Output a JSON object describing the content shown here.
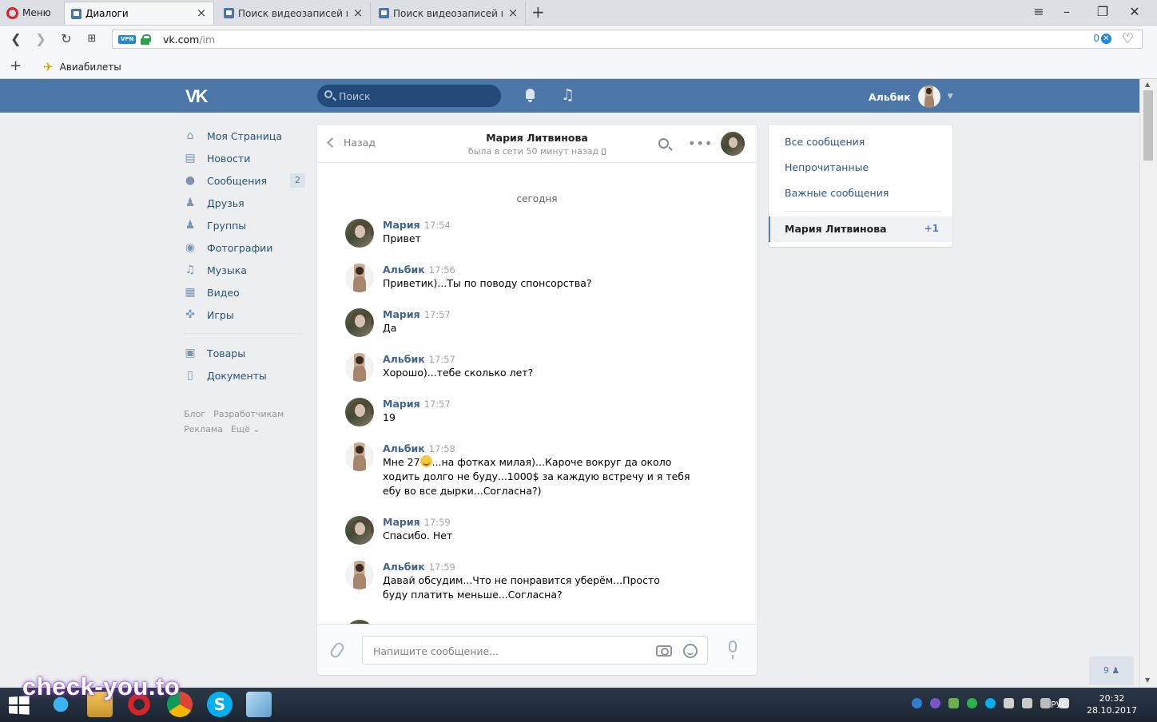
{
  "browser": {
    "menu_label": "Меню",
    "tabs": [
      {
        "title": "Диалоги",
        "active": true
      },
      {
        "title": "Поиск видеозаписей по з",
        "active": false
      },
      {
        "title": "Поиск видеозаписей по з",
        "active": false
      }
    ],
    "url_host": "vk.com",
    "url_path": "/im",
    "vpn_label": "VPN",
    "adblock_count": "0",
    "bookmark": "Авиабилеты",
    "accent": "#4a76a8"
  },
  "vk": {
    "search_placeholder": "Поиск",
    "user_name": "Альбик",
    "menu": [
      {
        "label": "Моя Страница",
        "icon": "home-icon"
      },
      {
        "label": "Новости",
        "icon": "news-icon"
      },
      {
        "label": "Сообщения",
        "icon": "messages-icon",
        "badge": "2"
      },
      {
        "label": "Друзья",
        "icon": "friend-icon"
      },
      {
        "label": "Группы",
        "icon": "groups-icon"
      },
      {
        "label": "Фотографии",
        "icon": "camera-icon"
      },
      {
        "label": "Музыка",
        "icon": "music-icon"
      },
      {
        "label": "Видео",
        "icon": "video-icon"
      },
      {
        "label": "Игры",
        "icon": "gamepad-icon"
      }
    ],
    "menu2": [
      {
        "label": "Товары",
        "icon": "bag-icon"
      },
      {
        "label": "Документы",
        "icon": "document-icon"
      }
    ],
    "footer": [
      "Блог",
      "Разработчикам",
      "Реклама",
      "Ещё ⌄"
    ]
  },
  "chat": {
    "back_label": "Назад",
    "peer_name": "Мария Литвинова",
    "peer_status": "была в сети 50 минут назад",
    "date_separator": "сегодня",
    "messages": [
      {
        "author": "Мария",
        "time": "17:54",
        "text": "Привет",
        "avatar": "maria"
      },
      {
        "author": "Альбик",
        "time": "17:56",
        "text": "Приветик)...Ты по поводу спонсорства?",
        "avatar": "albik"
      },
      {
        "author": "Мария",
        "time": "17:57",
        "text": "Да",
        "avatar": "maria"
      },
      {
        "author": "Альбик",
        "time": "17:57",
        "text": "Хорошо)...тебе сколько лет?",
        "avatar": "albik"
      },
      {
        "author": "Мария",
        "time": "17:57",
        "text": "19",
        "avatar": "maria"
      },
      {
        "author": "Альбик",
        "time": "17:58",
        "text_before_emoji": "Мне 27",
        "text_after_emoji": "...на фотках милая)...Кароче вокруг да около ходить долго не буду...1000$ за каждую встречу и я тебя ебу во все дырки...Согласна?)",
        "avatar": "albik"
      },
      {
        "author": "Мария",
        "time": "17:59",
        "text": "Спасибо. Нет",
        "avatar": "maria"
      },
      {
        "author": "Альбик",
        "time": "17:59",
        "text": "Давай обсудим...Что не понравится уберём...Просто буду платить меньше...Согласна?",
        "avatar": "albik"
      }
    ],
    "input_placeholder": "Напишите сообщение..."
  },
  "filters": {
    "all": "Все сообщения",
    "unread": "Непрочитанные",
    "important": "Важные сообщения",
    "conversation": "Мария Литвинова",
    "conversation_count": "+1"
  },
  "online_count": "9",
  "taskbar": {
    "language": "РУС",
    "time": "20:32",
    "date": "28.10.2017"
  },
  "watermark": "check-you.to"
}
